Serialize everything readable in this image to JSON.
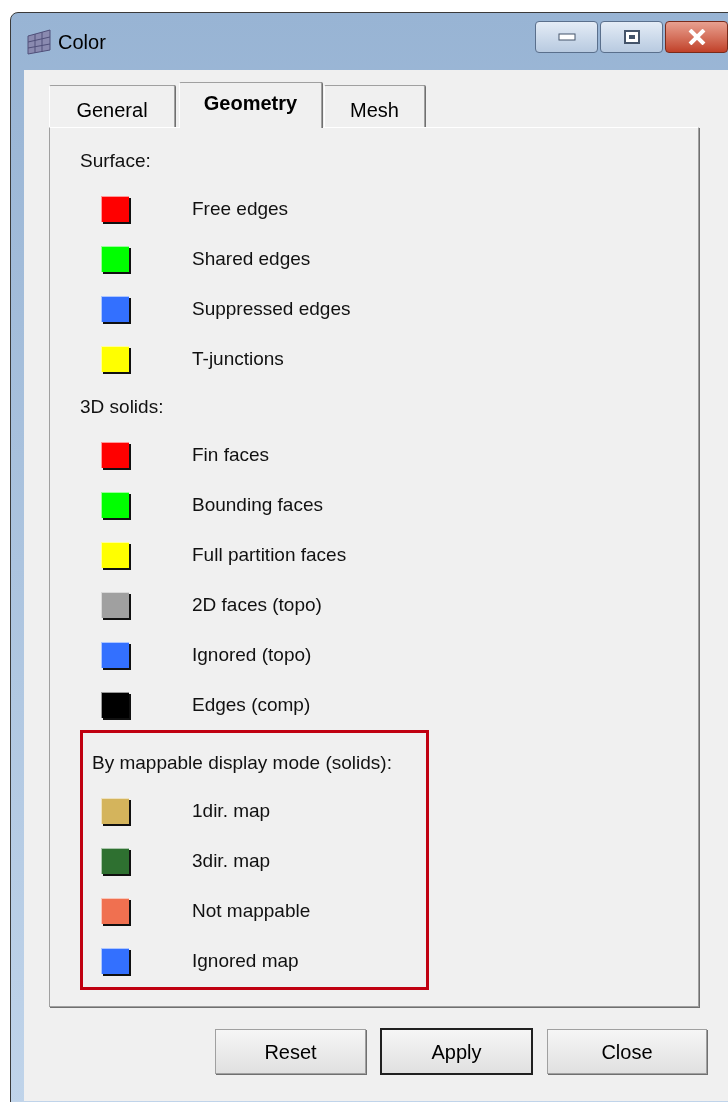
{
  "window": {
    "title": "Color"
  },
  "tabs": [
    {
      "label": "General",
      "selected": false
    },
    {
      "label": "Geometry",
      "selected": true
    },
    {
      "label": "Mesh",
      "selected": false
    }
  ],
  "sections": [
    {
      "heading": "Surface:",
      "highlighted": false,
      "items": [
        {
          "label": "Free edges",
          "color": "#ff0000"
        },
        {
          "label": "Shared edges",
          "color": "#00ff00"
        },
        {
          "label": "Suppressed edges",
          "color": "#3370ff"
        },
        {
          "label": "T-junctions",
          "color": "#ffff00"
        }
      ]
    },
    {
      "heading": "3D solids:",
      "highlighted": false,
      "items": [
        {
          "label": "Fin faces",
          "color": "#ff0000"
        },
        {
          "label": "Bounding faces",
          "color": "#00ff00"
        },
        {
          "label": "Full partition faces",
          "color": "#ffff00"
        },
        {
          "label": "2D faces (topo)",
          "color": "#a0a0a0"
        },
        {
          "label": "Ignored (topo)",
          "color": "#3370ff"
        },
        {
          "label": "Edges (comp)",
          "color": "#000000"
        }
      ]
    },
    {
      "heading": "By mappable display mode (solids):",
      "highlighted": true,
      "items": [
        {
          "label": "1dir. map",
          "color": "#d4b45c"
        },
        {
          "label": "3dir. map",
          "color": "#2e7030"
        },
        {
          "label": "Not mappable",
          "color": "#f07050"
        },
        {
          "label": "Ignored map",
          "color": "#3370ff"
        }
      ]
    }
  ],
  "buttons": [
    {
      "label": "Reset",
      "default": false
    },
    {
      "label": "Apply",
      "default": true
    },
    {
      "label": "Close",
      "default": false
    }
  ]
}
